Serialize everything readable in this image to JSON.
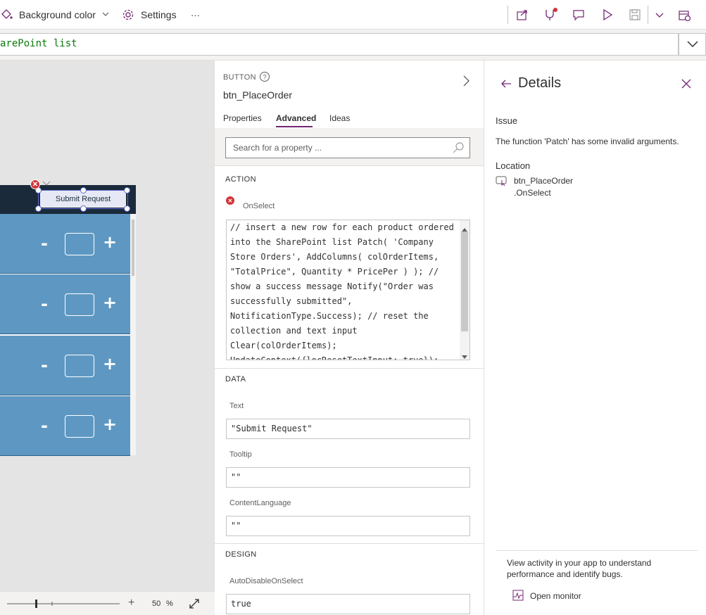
{
  "toolbar": {
    "background_color_label": "Background color",
    "settings_label": "Settings",
    "more_label": "···"
  },
  "formula": {
    "value": "arePoint list"
  },
  "canvas": {
    "submit_button_label": "Submit Request",
    "gallery_rows": [
      {
        "minus": "-",
        "plus": "+"
      },
      {
        "minus": "-",
        "plus": "+"
      },
      {
        "minus": "-",
        "plus": "+"
      },
      {
        "minus": "-",
        "plus": "+"
      }
    ],
    "zoom_value": "50",
    "zoom_unit": "%"
  },
  "properties": {
    "control_kind": "BUTTON",
    "control_name": "btn_PlaceOrder",
    "tabs": [
      "Properties",
      "Advanced",
      "Ideas"
    ],
    "active_tab": "Advanced",
    "search_placeholder": "Search for a property ...",
    "sections": {
      "action": "ACTION",
      "data": "DATA",
      "design": "DESIGN"
    },
    "onselect": {
      "label": "OnSelect",
      "code": "// insert a new row for each product ordered into the SharePoint list Patch( 'Company Store Orders', AddColumns( colOrderItems, \"TotalPrice\", Quantity * PricePer ) ); // show a success message Notify(\"Order was successfully submitted\", NotificationType.Success); // reset the collection and text input Clear(colOrderItems); UpdateContext({locResetTextInput: true});"
    },
    "text": {
      "label": "Text",
      "value": "\"Submit Request\""
    },
    "tooltip": {
      "label": "Tooltip",
      "value": "\"\""
    },
    "content_language": {
      "label": "ContentLanguage",
      "value": "\"\""
    },
    "auto_disable": {
      "label": "AutoDisableOnSelect",
      "value": "true"
    }
  },
  "details": {
    "title": "Details",
    "issue_label": "Issue",
    "issue_text": "The function 'Patch' has some invalid arguments.",
    "location_label": "Location",
    "location_control": "btn_PlaceOrder",
    "location_property": ".OnSelect",
    "monitor_text": "View activity in your app to understand performance and identify bugs.",
    "open_monitor_label": "Open monitor"
  },
  "colors": {
    "accent": "#742774",
    "error": "#d13438",
    "app_header": "#1b2a3a",
    "gallery_row": "#5e98c2"
  }
}
